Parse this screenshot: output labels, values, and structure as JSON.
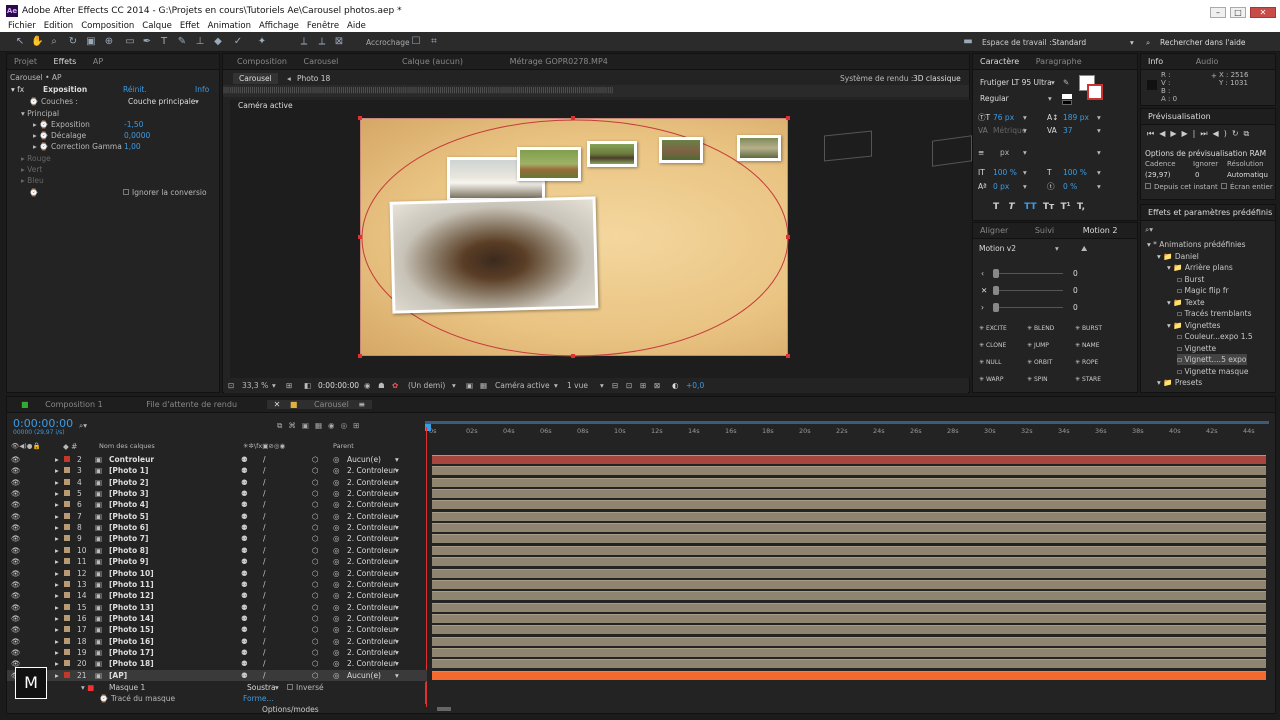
{
  "window": {
    "title": "Adobe After Effects CC 2014 - G:\\Projets en cours\\Tutoriels Ae\\Carousel photos.aep *",
    "app_icon": "Ae"
  },
  "menu": [
    "Fichier",
    "Edition",
    "Composition",
    "Calque",
    "Effet",
    "Animation",
    "Affichage",
    "Fenêtre",
    "Aide"
  ],
  "toolbar": {
    "snap_label": "Accrochage",
    "workspace_label": "Espace de travail :",
    "workspace_value": "Standard",
    "search_placeholder": "Rechercher dans l'aide"
  },
  "project_panel": {
    "tabs": [
      "Projet",
      "Effets",
      "AP"
    ],
    "breadcrumb": "Carousel • AP",
    "effect_name": "Exposition",
    "reset": "Réinit.",
    "info": "Info",
    "couches_label": "Couches :",
    "couches_value": "Couche principale",
    "principal": "Principal",
    "exposition_label": "Exposition",
    "exposition_value": "-1,50",
    "decalage_label": "Décalage",
    "decalage_value": "0,0000",
    "gamma_label": "Correction Gamma",
    "gamma_value": "1,00",
    "rouge": "Rouge",
    "vert": "Vert",
    "bleu": "Bleu",
    "ignore": "Ignorer la conversio"
  },
  "comp_panel": {
    "tab_comp": "Composition",
    "tab_comp_name": "Carousel",
    "tab_calque": "Calque (aucun)",
    "tab_metrage": "Métrage GOPR0278.MP4",
    "sub_tab1": "Carousel",
    "sub_tab2": "Photo 18",
    "render_label": "Système de rendu :",
    "render_value": "3D classique",
    "camera_active": "Caméra active",
    "zoom": "33,3 %",
    "time": "0:00:00:00",
    "resolution": "(Un demi)",
    "camera": "Caméra active",
    "views": "1 vue",
    "exposure": "+0,0"
  },
  "character_panel": {
    "tabs": [
      "Caractère",
      "Paragraphe"
    ],
    "font": "Frutiger LT 95 Ultra",
    "style": "Regular",
    "size": "76 px",
    "leading": "189 px",
    "kerning": "Métrique",
    "tracking": "37",
    "stroke_unit": "px",
    "vscale": "100 %",
    "hscale": "100 %",
    "baseline": "0 px",
    "tsume": "0 %"
  },
  "motion_panel": {
    "tabs": [
      "Aligner",
      "Suivi",
      "Motion 2"
    ],
    "preset": "Motion v2",
    "values": [
      "0",
      "0",
      "0"
    ],
    "buttons": [
      "EXCITE",
      "BLEND",
      "BURST",
      "CLONE",
      "JUMP",
      "NAME",
      "NULL",
      "ORBIT",
      "ROPE",
      "WARP",
      "SPIN",
      "STARE"
    ]
  },
  "info_panel": {
    "tabs": [
      "Info",
      "Audio"
    ],
    "rgb": [
      "R :",
      "V :",
      "B :",
      "A : 0"
    ],
    "x": "X : 2516",
    "y": "Y : 1031"
  },
  "preview_panel": {
    "title": "Prévisualisation",
    "ram_options": "Options de prévisualisation RAM",
    "cadence_label": "Cadence",
    "ignore_label": "Ignorer",
    "resolution_label": "Résolution",
    "cadence_value": "(29,97)",
    "ignore_value": "0",
    "resolution_value": "Automatiqu",
    "from_now": "Depuis cet instant",
    "fullscreen": "Écran entier"
  },
  "effects_panel": {
    "title": "Effets et paramètres prédéfinis",
    "tree": [
      {
        "label": "* Animations prédéfinies",
        "indent": 0
      },
      {
        "label": "Daniel",
        "indent": 1
      },
      {
        "label": "Arrière plans",
        "indent": 2
      },
      {
        "label": "Burst",
        "indent": 3
      },
      {
        "label": "Magic flip fr",
        "indent": 3
      },
      {
        "label": "Texte",
        "indent": 2
      },
      {
        "label": "Tracés tremblants",
        "indent": 3
      },
      {
        "label": "Vignettes",
        "indent": 2
      },
      {
        "label": "Couleur...expo 1.5",
        "indent": 3
      },
      {
        "label": "Vignette",
        "indent": 3
      },
      {
        "label": "Vignett....5 expo",
        "indent": 3
      },
      {
        "label": "Vignette masque",
        "indent": 3
      },
      {
        "label": "Presets",
        "indent": 1
      }
    ]
  },
  "timeline": {
    "tabs": [
      "Composition 1",
      "File d'attente de rendu",
      "Carousel"
    ],
    "timecode": "0:00:00:00",
    "timecode_sub": "00000 (29,97 i/s)",
    "col_name": "Nom des calques",
    "col_parent": "Parent",
    "ruler": [
      "0s",
      "02s",
      "04s",
      "06s",
      "08s",
      "10s",
      "12s",
      "14s",
      "16s",
      "18s",
      "20s",
      "22s",
      "24s",
      "26s",
      "28s",
      "30s",
      "32s",
      "34s",
      "36s",
      "38s",
      "40s",
      "42s",
      "44s"
    ],
    "layers": [
      {
        "num": "2",
        "name": "Controleur",
        "parent": "Aucun(e)",
        "color": "#c0392b",
        "bar": "#a7463f"
      },
      {
        "num": "3",
        "name": "[Photo 1]",
        "parent": "2. Controleur",
        "color": "#b99b73",
        "bar": "#8f8470"
      },
      {
        "num": "4",
        "name": "[Photo 2]",
        "parent": "2. Controleur",
        "color": "#b99b73",
        "bar": "#8f8470"
      },
      {
        "num": "5",
        "name": "[Photo 3]",
        "parent": "2. Controleur",
        "color": "#b99b73",
        "bar": "#8f8470"
      },
      {
        "num": "6",
        "name": "[Photo 4]",
        "parent": "2. Controleur",
        "color": "#b99b73",
        "bar": "#8f8470"
      },
      {
        "num": "7",
        "name": "[Photo 5]",
        "parent": "2. Controleur",
        "color": "#b99b73",
        "bar": "#8f8470"
      },
      {
        "num": "8",
        "name": "[Photo 6]",
        "parent": "2. Controleur",
        "color": "#b99b73",
        "bar": "#8f8470"
      },
      {
        "num": "9",
        "name": "[Photo 7]",
        "parent": "2. Controleur",
        "color": "#b99b73",
        "bar": "#8f8470"
      },
      {
        "num": "10",
        "name": "[Photo 8]",
        "parent": "2. Controleur",
        "color": "#b99b73",
        "bar": "#8f8470"
      },
      {
        "num": "11",
        "name": "[Photo 9]",
        "parent": "2. Controleur",
        "color": "#b99b73",
        "bar": "#8f8470"
      },
      {
        "num": "12",
        "name": "[Photo 10]",
        "parent": "2. Controleur",
        "color": "#b99b73",
        "bar": "#8f8470"
      },
      {
        "num": "13",
        "name": "[Photo 11]",
        "parent": "2. Controleur",
        "color": "#b99b73",
        "bar": "#8f8470"
      },
      {
        "num": "14",
        "name": "[Photo 12]",
        "parent": "2. Controleur",
        "color": "#b99b73",
        "bar": "#8f8470"
      },
      {
        "num": "15",
        "name": "[Photo 13]",
        "parent": "2. Controleur",
        "color": "#b99b73",
        "bar": "#8f8470"
      },
      {
        "num": "16",
        "name": "[Photo 14]",
        "parent": "2. Controleur",
        "color": "#b99b73",
        "bar": "#8f8470"
      },
      {
        "num": "17",
        "name": "[Photo 15]",
        "parent": "2. Controleur",
        "color": "#b99b73",
        "bar": "#8f8470"
      },
      {
        "num": "18",
        "name": "[Photo 16]",
        "parent": "2. Controleur",
        "color": "#b99b73",
        "bar": "#8f8470"
      },
      {
        "num": "19",
        "name": "[Photo 17]",
        "parent": "2. Controleur",
        "color": "#b99b73",
        "bar": "#8f8470"
      },
      {
        "num": "20",
        "name": "[Photo 18]",
        "parent": "2. Controleur",
        "color": "#b99b73",
        "bar": "#8f8470"
      },
      {
        "num": "21",
        "name": "[AP]",
        "parent": "Aucun(e)",
        "color": "#c0392b",
        "bar": "#f26a2f"
      }
    ],
    "mask_label": "Masque 1",
    "mask_mode": "Soustra",
    "mask_inverse": "Inversé",
    "mask_path": "Tracé du masque",
    "mask_path_value": "Forme...",
    "toggle_label": "Options/modes",
    "watermark": "M"
  }
}
